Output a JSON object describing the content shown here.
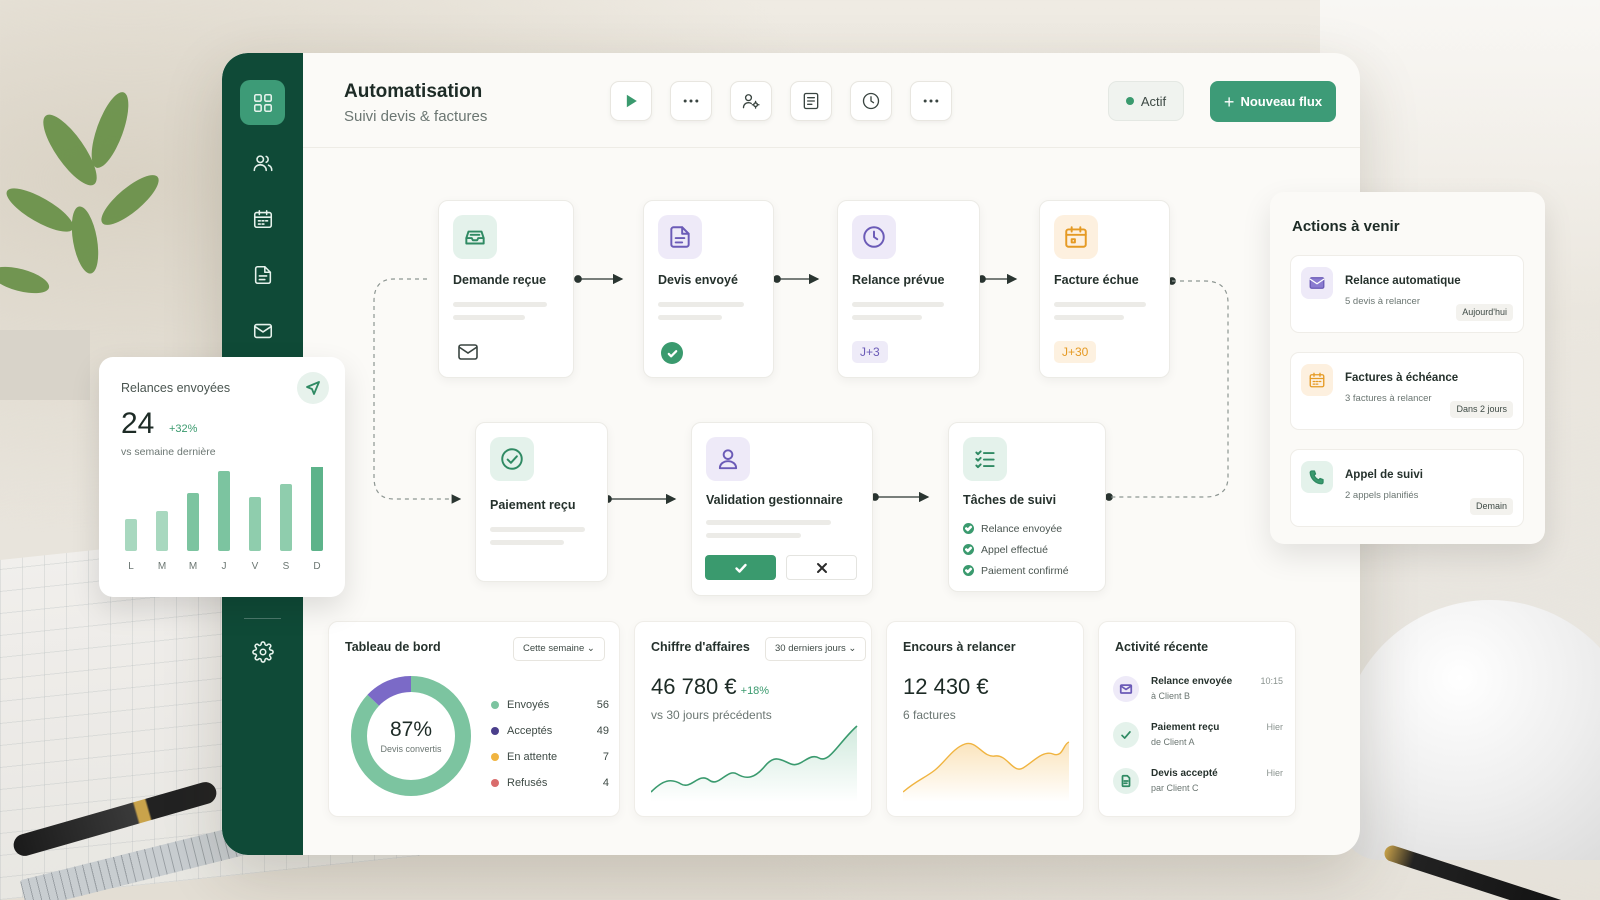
{
  "header": {
    "title": "Automatisation",
    "subtitle": "Suivi devis & factures",
    "status": "Actif",
    "new_flow_label": "Nouveau flux"
  },
  "toolbar": {
    "icons": [
      "play-icon",
      "more-icon",
      "user-settings-icon",
      "document-icon",
      "clock-icon",
      "more-icon"
    ]
  },
  "sidebar": {
    "items": [
      "dashboard-icon",
      "users-icon",
      "calendar-icon",
      "document-icon",
      "mail-icon",
      "settings-icon"
    ]
  },
  "flow": {
    "demande": {
      "title": "Demande reçue"
    },
    "devis": {
      "title": "Devis envoyé"
    },
    "relance": {
      "title": "Relance prévue",
      "badge": "J+3"
    },
    "facture": {
      "title": "Facture échue",
      "badge": "J+30"
    },
    "paiement": {
      "title": "Paiement reçu"
    },
    "validation": {
      "title": "Validation gestionnaire"
    },
    "taches": {
      "title": "Tâches de suivi",
      "items": [
        "Relance envoyée",
        "Appel effectué",
        "Paiement confirmé"
      ]
    }
  },
  "relances_card": {
    "title": "Relances envoyées",
    "value": "24",
    "growth": "+32%",
    "subtitle": "vs semaine dernière",
    "days": [
      "L",
      "M",
      "M",
      "J",
      "V",
      "S",
      "D"
    ]
  },
  "dashboard": {
    "title": "Tableau de bord",
    "period": "Cette semaine",
    "percent": "87%",
    "percent_label": "Devis convertis",
    "legend": [
      {
        "label": "Envoyés",
        "value": "56",
        "color": "#7cc4a0"
      },
      {
        "label": "Acceptés",
        "value": "49",
        "color": "#4b3f8c"
      },
      {
        "label": "En attente",
        "value": "7",
        "color": "#f0b440"
      },
      {
        "label": "Refusés",
        "value": "4",
        "color": "#d96c6c"
      }
    ]
  },
  "revenue": {
    "title": "Chiffre d'affaires",
    "period": "30 derniers jours",
    "value": "46 780 €",
    "growth": "+18%",
    "subtitle": "vs 30 jours précédents"
  },
  "outstanding": {
    "title": "Encours à relancer",
    "value": "12 430 €",
    "subtitle": "6 factures"
  },
  "activity": {
    "title": "Activité récente",
    "items": [
      {
        "title": "Relance envoyée",
        "sub": "à Client B",
        "time": "10:15"
      },
      {
        "title": "Paiement reçu",
        "sub": "de Client A",
        "time": "Hier"
      },
      {
        "title": "Devis accepté",
        "sub": "par Client C",
        "time": "Hier"
      }
    ]
  },
  "upcoming": {
    "title": "Actions à venir",
    "items": [
      {
        "title": "Relance automatique",
        "sub": "5 devis à relancer",
        "badge": "Aujourd'hui"
      },
      {
        "title": "Factures à échéance",
        "sub": "3 factures à relancer",
        "badge": "Dans 2 jours"
      },
      {
        "title": "Appel de suivi",
        "sub": "2 appels planifiés",
        "badge": "Demain"
      }
    ]
  },
  "colors": {
    "sidebar": "#0f4a37",
    "accent": "#3d9b77",
    "purple": "#6b5bb7",
    "orange": "#e59a24"
  }
}
